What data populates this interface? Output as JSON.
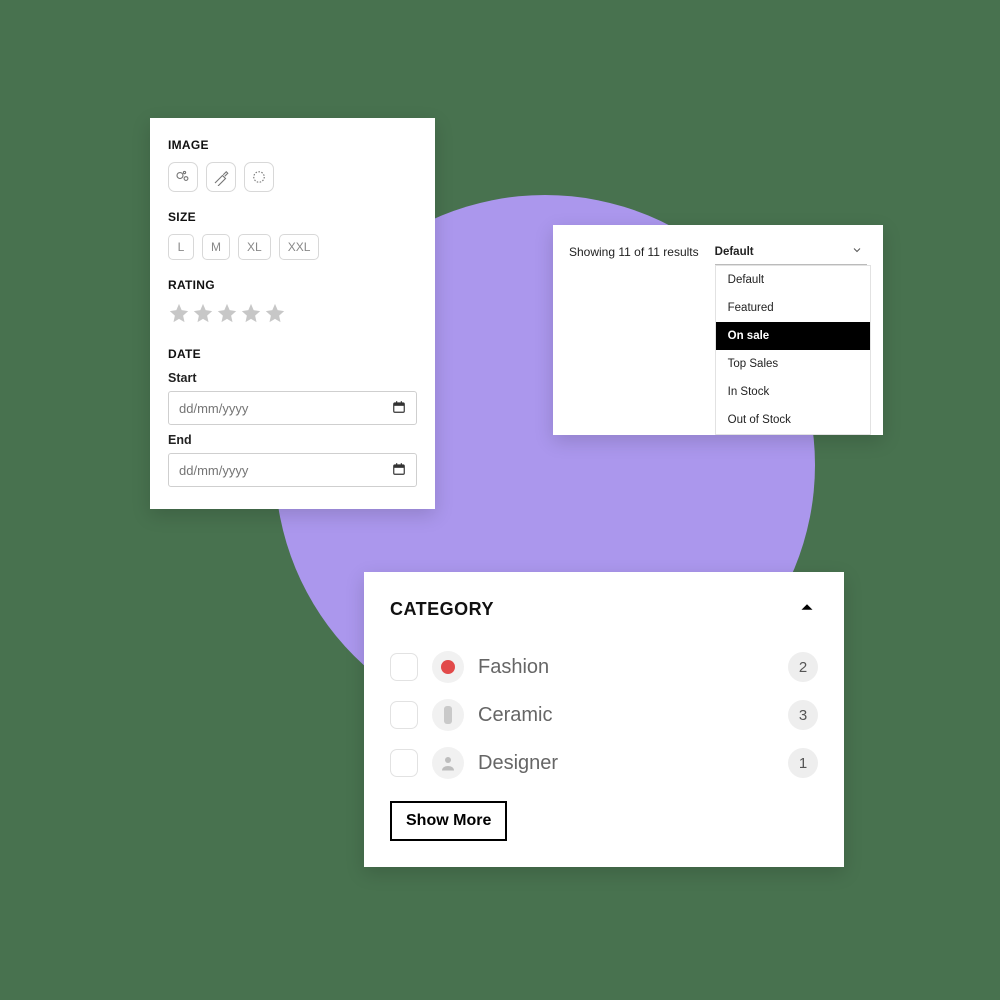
{
  "filter": {
    "image_title": "IMAGE",
    "size_title": "SIZE",
    "sizes": [
      "L",
      "M",
      "XL",
      "XXL"
    ],
    "rating_title": "RATING",
    "date_title": "DATE",
    "date_start_label": "Start",
    "date_end_label": "End",
    "date_placeholder": "dd/mm/yyyy"
  },
  "sort": {
    "results_text": "Showing 11 of 11 results",
    "selected": "Default",
    "options": [
      "Default",
      "Featured",
      "On sale",
      "Top Sales",
      "In Stock",
      "Out of Stock"
    ],
    "highlighted": "On sale"
  },
  "category": {
    "title": "CATEGORY",
    "items": [
      {
        "label": "Fashion",
        "count": "2",
        "color": "#e24a4a"
      },
      {
        "label": "Ceramic",
        "count": "3",
        "color": "#b8b8b8"
      },
      {
        "label": "Designer",
        "count": "1",
        "color": "#b8b8b8"
      }
    ],
    "show_more": "Show More"
  }
}
